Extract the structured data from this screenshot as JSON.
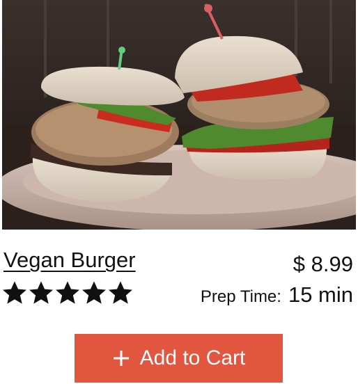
{
  "product": {
    "title": "Vegan Burger",
    "price": "$ 8.99",
    "rating": 5,
    "rating_max": 5,
    "prep_label": "Prep Time:",
    "prep_value": "15 min"
  },
  "cart_button": {
    "label": "Add to Cart",
    "icon": "plus-icon",
    "color": "#e2553f"
  },
  "image": {
    "subject": "two vegan burgers with lettuce and tomato on a plate"
  }
}
